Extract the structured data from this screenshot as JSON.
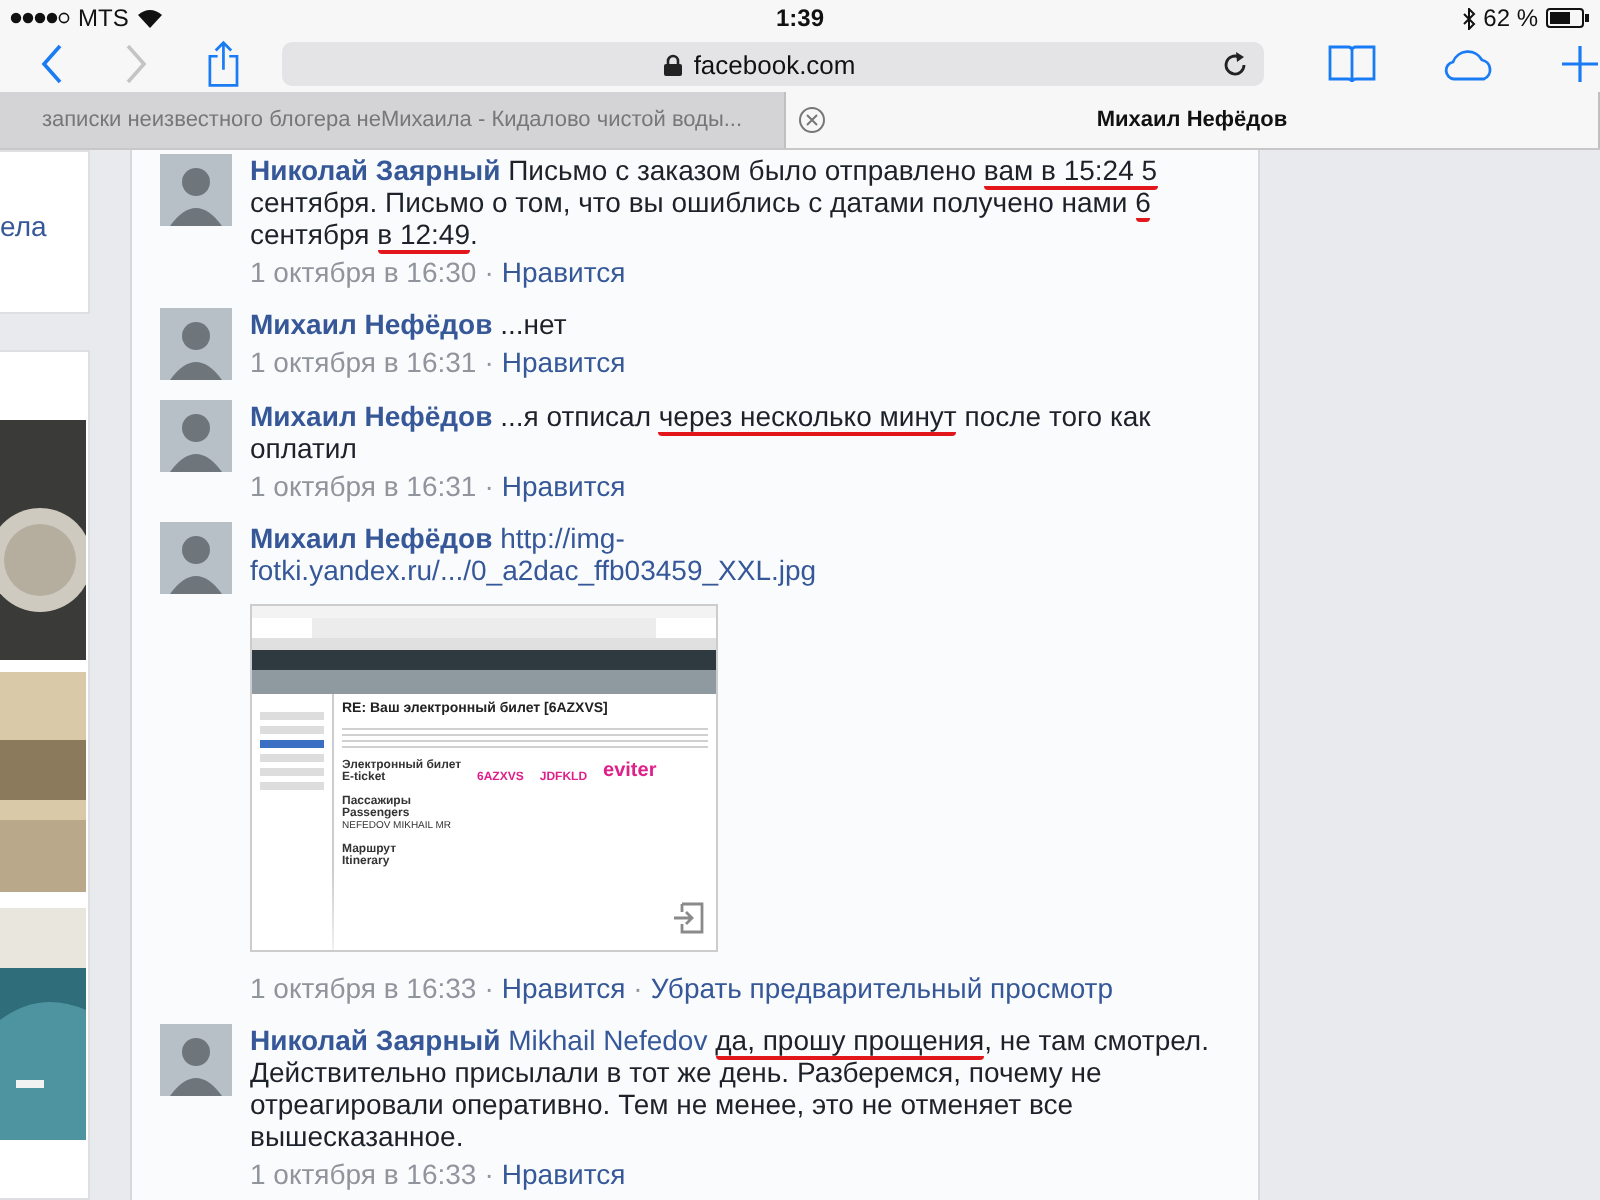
{
  "status_bar": {
    "carrier": "MTS",
    "time": "1:39",
    "battery": "62 %"
  },
  "toolbar": {
    "url": "facebook.com",
    "back_disabled": false,
    "forward_disabled": true
  },
  "tabs": [
    {
      "title": "записки неизвестного блогера неМихаила - Кидалово чистой воды...",
      "selected": false
    },
    {
      "title": "Михаил Нефёдов",
      "selected": true
    }
  ],
  "sidebar": {
    "card_text": "ела"
  },
  "comments": [
    {
      "author": "Николай Заярный",
      "segments": [
        {
          "text": "Письмо с заказом было отправлено ",
          "underlined": false
        },
        {
          "text": "вам в 15:24 5",
          "underlined": true
        },
        {
          "text": " сентября. Письмо о том, что вы ошиблись с датами получено нами ",
          "underlined": false
        },
        {
          "text": "6",
          "underlined": true
        },
        {
          "text": " сентября ",
          "underlined": false
        },
        {
          "text": "в 12:49",
          "underlined": true
        },
        {
          "text": ".",
          "underlined": false
        }
      ],
      "time": "1 октября в 16:30",
      "actions": [
        {
          "separator": "·",
          "label": "Нравится"
        }
      ]
    },
    {
      "author": "Михаил Нефёдов",
      "segments": [
        {
          "text": "...нет",
          "underlined": false
        }
      ],
      "time": "1 октября в 16:31",
      "actions": [
        {
          "separator": "·",
          "label": "Нравится"
        }
      ]
    },
    {
      "author": "Михаил Нефёдов",
      "segments": [
        {
          "text": "...я отписал ",
          "underlined": false
        },
        {
          "text": "через несколько минут",
          "underlined": true
        },
        {
          "text": " после того как оплатил",
          "underlined": false
        }
      ],
      "time": "1 октября в 16:31",
      "actions": [
        {
          "separator": "·",
          "label": "Нравится"
        }
      ]
    },
    {
      "author": "Михаил Нефёдов",
      "segments": [
        {
          "text": "http://img-fotki.yandex.ru/.../0_a2dac_ffb03459_XXL.jpg",
          "underlined": false,
          "link": true
        }
      ],
      "preview": {
        "title": "RE: Ваш электронный билет [6AZXVS]",
        "ticket_label": [
          "Электронный билет",
          "E-ticket"
        ],
        "codes": [
          "6AZXVS",
          "JDFKLD"
        ],
        "brand": "eviter",
        "passengers_label": [
          "Пассажиры",
          "Passengers"
        ],
        "passenger": "NEFEDOV MIKHAIL MR",
        "route_label": [
          "Маршрут",
          "Itinerary"
        ]
      },
      "time": "1 октября в 16:33",
      "actions": [
        {
          "separator": "·",
          "label": "Нравится"
        },
        {
          "separator": "·",
          "label": "Убрать предварительный просмотр"
        }
      ]
    },
    {
      "author": "Николай Заярный",
      "segments": [
        {
          "text": "Mikhail Nefedov",
          "underlined": false,
          "link": true
        },
        {
          "text": "да, прошу прощения",
          "underlined": true
        },
        {
          "text": ", не там смотрел. Действительно присылали в тот же день. Разберемся, почему не отреагировали оперативно. Тем не менее, это не отменяет все вышесказанное.",
          "underlined": false
        }
      ],
      "time": "1 октября в 16:33",
      "actions": [
        {
          "separator": "·",
          "label": "Нравится"
        }
      ]
    }
  ]
}
